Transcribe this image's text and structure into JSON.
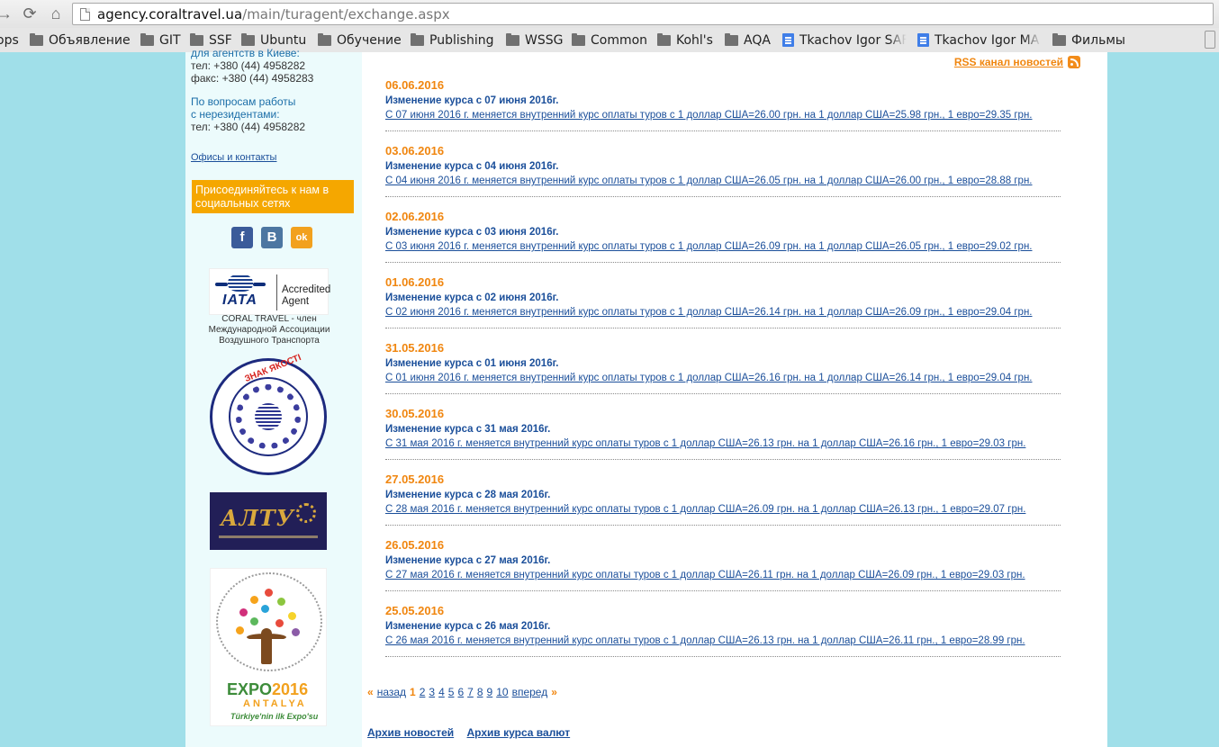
{
  "browser": {
    "url_host": "agency.coraltravel.ua",
    "url_path": "/main/turagent/exchange.aspx",
    "bookmarks": [
      {
        "label": "ops",
        "icon": "apps-icon"
      },
      {
        "label": "Объявление",
        "icon": "folder-icon"
      },
      {
        "label": "GIT",
        "icon": "folder-icon"
      },
      {
        "label": "SSF",
        "icon": "folder-icon"
      },
      {
        "label": "Ubuntu",
        "icon": "folder-icon"
      },
      {
        "label": "Обучение",
        "icon": "folder-icon"
      },
      {
        "label": "Publishing",
        "icon": "folder-icon"
      },
      {
        "label": "WSSG",
        "icon": "folder-icon"
      },
      {
        "label": "Common",
        "icon": "folder-icon"
      },
      {
        "label": "Kohl's",
        "icon": "folder-icon"
      },
      {
        "label": "AQA",
        "icon": "folder-icon"
      },
      {
        "label": "Tkachov Igor SAF",
        "icon": "doc-icon"
      },
      {
        "label": "Tkachov Igor MA",
        "icon": "doc-icon"
      },
      {
        "label": "Фильмы",
        "icon": "folder-icon"
      }
    ]
  },
  "sidebar": {
    "kiev_heading": "для агентств в Киеве:",
    "kiev_phone": "тел: +380 (44) 4958282",
    "kiev_fax": "факс: +380 (44) 4958283",
    "nonres_heading_1": "По вопросам работы",
    "nonres_heading_2": "с нерезидентами:",
    "nonres_phone": "тел: +380 (44) 4958282",
    "offices_link": "Офисы и контакты",
    "social_banner": "Присоединяйтесь к нам в социальных сетях",
    "social": {
      "facebook": "f",
      "vkontakte": "B",
      "odnoklassniki": "ok"
    },
    "iata": {
      "logo": "IATA",
      "badge_1": "Accredited",
      "badge_2": "Agent",
      "caption": "CORAL TRAVEL - член Международной Ассоциации Воздушного Транспорта"
    },
    "seal": {
      "top_text": "ЗНАК ЯКОСТІ"
    },
    "alty": {
      "logo": "АЛТУ"
    },
    "expo": {
      "title_a": "EXPO",
      "title_b": "2016",
      "subtitle": "ANTALYA",
      "foot": "Türkiye'nin ilk Expo'su"
    }
  },
  "main": {
    "rss_label": "RSS канал новостей",
    "news": [
      {
        "date": "06.06.2016",
        "title": "Изменение курса с 07 июня 2016г.",
        "text": "С 07 июня 2016 г. меняется внутренний курс оплаты туров с 1 доллар США=26.00 грн. на 1 доллар США=25.98 грн., 1 евро=29.35 грн."
      },
      {
        "date": "03.06.2016",
        "title": "Изменение курса с 04 июня 2016г.",
        "text": "С 04 июня 2016 г. меняется внутренний курс оплаты туров с 1 доллар США=26.05 грн. на 1 доллар США=26.00 грн., 1 евро=28.88 грн."
      },
      {
        "date": "02.06.2016",
        "title": "Изменение курса с 03 июня 2016г.",
        "text": "С 03 июня 2016 г. меняется внутренний курс оплаты туров с 1 доллар США=26.09 грн. на 1 доллар США=26.05 грн., 1 евро=29.02 грн."
      },
      {
        "date": "01.06.2016",
        "title": "Изменение курса с 02 июня 2016г.",
        "text": "С 02 июня 2016 г. меняется внутренний курс оплаты туров с 1 доллар США=26.14 грн. на 1 доллар США=26.09 грн., 1 евро=29.04 грн."
      },
      {
        "date": "31.05.2016",
        "title": "Изменение курса с 01 июня 2016г.",
        "text": "С 01 июня 2016 г. меняется внутренний курс оплаты туров с 1 доллар США=26.16 грн. на 1 доллар США=26.14 грн., 1 евро=29.04 грн."
      },
      {
        "date": "30.05.2016",
        "title": "Изменение курса с 31 мая 2016г.",
        "text": "С 31 мая 2016 г. меняется внутренний курс оплаты туров с 1 доллар США=26.13 грн. на 1 доллар США=26.16 грн., 1 евро=29.03 грн."
      },
      {
        "date": "27.05.2016",
        "title": "Изменение курса с 28 мая 2016г.",
        "text": "С 28 мая 2016 г. меняется внутренний курс оплаты туров с 1 доллар США=26.09 грн. на 1 доллар США=26.13 грн., 1 евро=29.07 грн."
      },
      {
        "date": "26.05.2016",
        "title": "Изменение курса с 27 мая 2016г.",
        "text": "С 27 мая 2016 г. меняется внутренний курс оплаты туров с 1 доллар США=26.11 грн. на 1 доллар США=26.09 грн., 1 евро=29.03 грн."
      },
      {
        "date": "25.05.2016",
        "title": "Изменение курса с 26 мая 2016г.",
        "text": "С 26 мая 2016 г. меняется внутренний курс оплаты туров с 1 доллар США=26.13 грн. на 1 доллар США=26.11 грн., 1 евро=28.99 грн."
      }
    ],
    "pager": {
      "prev_arrow": "«",
      "prev": "назад",
      "current": "1",
      "pages": [
        "2",
        "3",
        "4",
        "5",
        "6",
        "7",
        "8",
        "9",
        "10"
      ],
      "next": "вперед",
      "next_arrow": "»"
    },
    "archives": {
      "news": "Архив новостей",
      "rates": "Архив курса валют"
    }
  }
}
